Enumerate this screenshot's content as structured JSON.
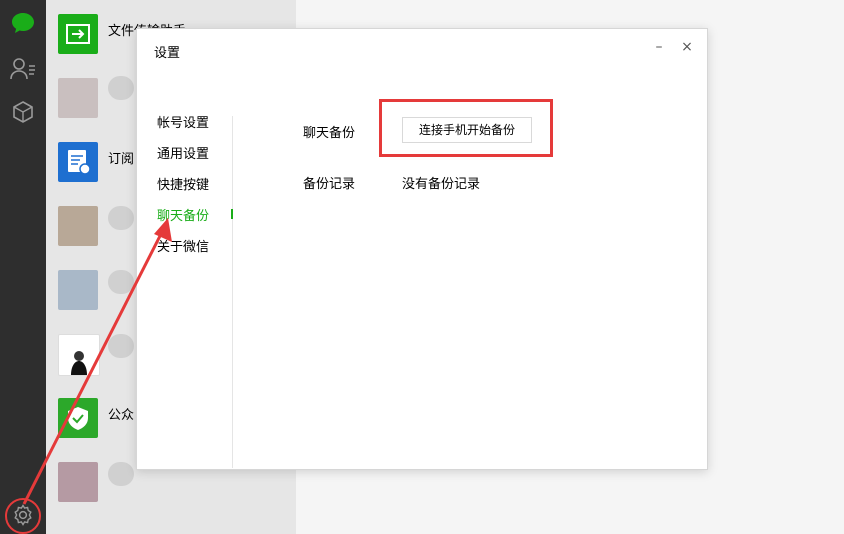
{
  "sidebar": {
    "icons": [
      "chat-icon",
      "contacts-icon",
      "favorites-icon",
      "settings-icon"
    ]
  },
  "chat_list": {
    "items": [
      {
        "name": "文件传输助手"
      },
      {
        "name": ""
      },
      {
        "name": "订阅"
      },
      {
        "name": ""
      },
      {
        "name": ""
      },
      {
        "name": ""
      },
      {
        "name": "公众"
      },
      {
        "name": ""
      }
    ]
  },
  "dialog": {
    "title": "设置",
    "minimize": "–",
    "close": "×",
    "menu": [
      {
        "label": "帐号设置"
      },
      {
        "label": "通用设置"
      },
      {
        "label": "快捷按键"
      },
      {
        "label": "聊天备份"
      },
      {
        "label": "关于微信"
      }
    ],
    "backup": {
      "label": "聊天备份",
      "button": "连接手机开始备份",
      "record_label": "备份记录",
      "record_value": "没有备份记录"
    }
  },
  "colors": {
    "accent": "#1aad19",
    "highlight": "#e53a3a",
    "sidebar": "#2e2e2e"
  }
}
